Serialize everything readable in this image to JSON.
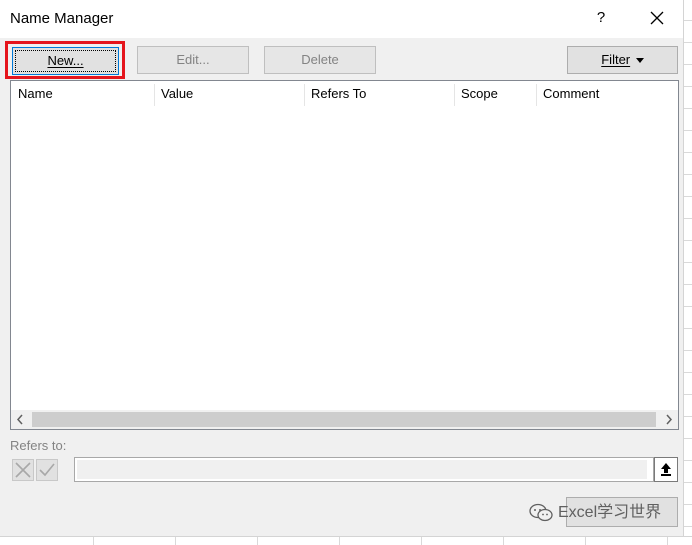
{
  "dialog": {
    "title": "Name Manager",
    "help_label": "?"
  },
  "toolbar": {
    "new_label": "New...",
    "edit_label": "Edit...",
    "delete_label": "Delete",
    "filter_label": "Filter"
  },
  "list": {
    "columns": [
      "Name",
      "Value",
      "Refers To",
      "Scope",
      "Comment"
    ],
    "rows": []
  },
  "refers_to": {
    "label": "Refers to:",
    "value": ""
  },
  "watermark": {
    "text": "Excel学习世界"
  },
  "colors": {
    "highlight": "#e5141c",
    "dialog_bg": "#f0f0f0",
    "focus_border": "#0078d7"
  },
  "icons": [
    "help-icon",
    "close-icon",
    "dropdown-arrow-icon",
    "scroll-left-icon",
    "scroll-right-icon",
    "cancel-x-icon",
    "confirm-check-icon",
    "collapse-dialog-icon",
    "wechat-icon"
  ]
}
